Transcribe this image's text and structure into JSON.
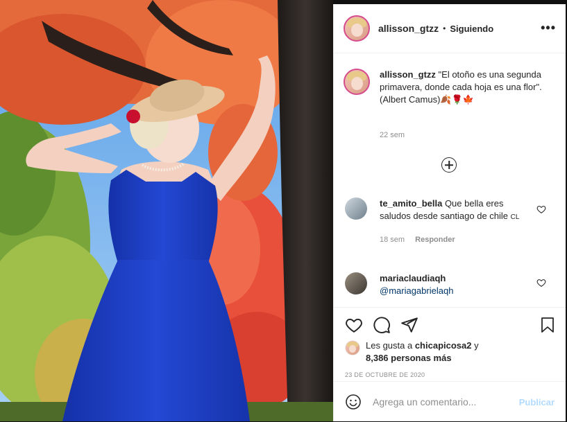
{
  "post": {
    "username": "allisson_gtzz",
    "separator": "•",
    "follow_status": "Siguiendo",
    "more_glyph": "•••",
    "caption_user": "allisson_gtzz",
    "caption_line1": " \"El otoño es una segunda primavera, donde cada hoja es una flor\".",
    "caption_line2": "(Albert Camus)",
    "caption_emojis": "🍂🌹🍁",
    "caption_time": "22 sem"
  },
  "comments": [
    {
      "user": "te_amito_bella",
      "text": " Que bella eres saludos desde santiago de chile ",
      "flag": "CL",
      "time": "18 sem",
      "reply_label": "Responder"
    },
    {
      "user": "mariaclaudiaqh",
      "mention": "@mariagabrielaqh"
    }
  ],
  "likes": {
    "prefix": "Les gusta a ",
    "user": "chicapicosa2",
    "suffix": " y",
    "count_text": "8,386 personas más"
  },
  "date": "23 DE OCTUBRE DE 2020",
  "add_comment": {
    "placeholder": "Agrega un comentario...",
    "publish_label": "Publicar"
  },
  "icons": [
    "emoji-icon",
    "heart-icon",
    "comment-icon",
    "share-icon",
    "bookmark-icon",
    "add-comment-icon",
    "more-options-icon"
  ],
  "colors": {
    "link": "#00376b",
    "publish_disabled": "#b3dbff",
    "muted": "#8e8e8e",
    "text": "#262626"
  }
}
